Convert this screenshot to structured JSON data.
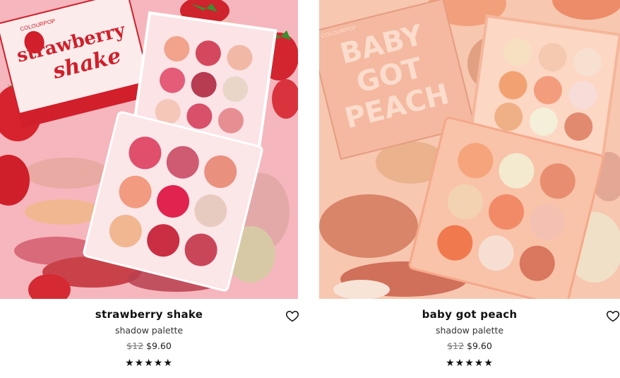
{
  "products": [
    {
      "title": "strawberry shake",
      "subtitle": "shadow palette",
      "price_old": "$12",
      "price_new": "$9.60",
      "stars": "★★★★★",
      "box_text_1": "strawberry",
      "box_text_2": "shake",
      "brand": "COLOURPOP"
    },
    {
      "title": "baby got peach",
      "subtitle": "shadow palette",
      "price_old": "$12",
      "price_new": "$9.60",
      "stars": "★★★★★",
      "box_text_1": "BABY",
      "box_text_2": "GOT",
      "box_text_3": "PEACH",
      "brand": "COLOURPOP"
    }
  ],
  "icons": {
    "favorite": "heart-icon",
    "rating": "star-icon"
  }
}
